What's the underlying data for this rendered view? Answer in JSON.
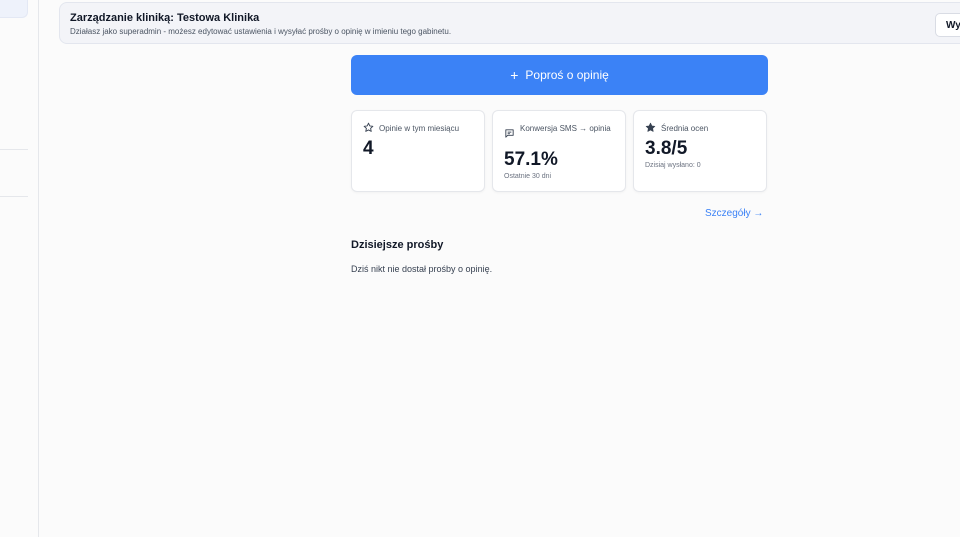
{
  "banner": {
    "title": "Zarządzanie kliniką: Testowa Klinika",
    "subtitle": "Działasz jako superadmin - możesz edytować ustawienia i wysyłać prośby o opinię w imieniu tego gabinetu.",
    "exit_label": "Wyjdź"
  },
  "cta": {
    "icon": "plus-icon",
    "label": "Poproś o opinię"
  },
  "stats": {
    "reviews_month": {
      "icon": "star-outline-icon",
      "label": "Opinie w tym miesiącu",
      "value": "4"
    },
    "conversion": {
      "icon": "message-icon",
      "label": "Konwersja SMS → opinia",
      "value": "57.1%",
      "note": "Ostatnie 30 dni"
    },
    "rating": {
      "icon": "star-filled-icon",
      "label": "Średnia ocen",
      "value": "3.8/5",
      "note": "Dzisiaj wysłano: 0"
    }
  },
  "details_link": "Szczegóły →",
  "today": {
    "title": "Dzisiejsze prośby",
    "empty": "Dziś nikt nie dostał prośby o opinię."
  },
  "colors": {
    "accent": "#3b82f6",
    "banner_bg": "#f3f4f8",
    "page_bg": "#fbfbfb"
  }
}
